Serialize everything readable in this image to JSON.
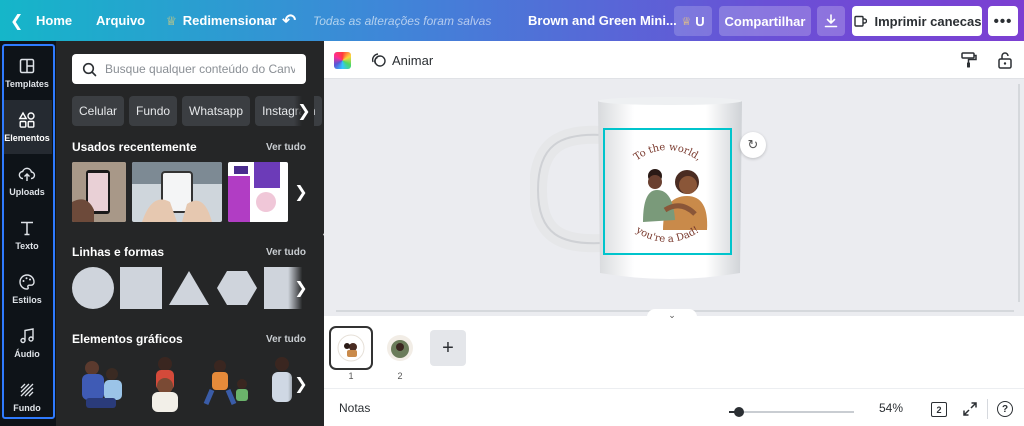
{
  "topbar": {
    "home": "Home",
    "file": "Arquivo",
    "resize": "Redimensionar",
    "saved_status": "Todas as alterações foram salvas",
    "doc_title": "Brown and Green Mini...",
    "upgrade_short": "U",
    "share": "Compartilhar",
    "print": "Imprimir canecas"
  },
  "rail": [
    {
      "label": "Templates",
      "icon": "templates-icon"
    },
    {
      "label": "Elementos",
      "icon": "elements-icon"
    },
    {
      "label": "Uploads",
      "icon": "upload-icon"
    },
    {
      "label": "Texto",
      "icon": "text-icon"
    },
    {
      "label": "Estilos",
      "icon": "palette-icon"
    },
    {
      "label": "Áudio",
      "icon": "music-icon"
    },
    {
      "label": "Fundo",
      "icon": "background-icon"
    }
  ],
  "panel": {
    "search_placeholder": "Busque qualquer conteúdo do Canva",
    "chips": [
      "Celular",
      "Fundo",
      "Whatsapp",
      "Instagram"
    ],
    "recent": {
      "title": "Usados recentemente",
      "link": "Ver tudo"
    },
    "shapes": {
      "title": "Linhas e formas",
      "link": "Ver tudo"
    },
    "graphics": {
      "title": "Elementos gráficos",
      "link": "Ver tudo"
    }
  },
  "editor": {
    "animate": "Animar"
  },
  "design": {
    "text_top": "To the world,",
    "text_bottom": "you're a Dad!"
  },
  "pages": {
    "numbers": [
      "1",
      "2"
    ]
  },
  "footer": {
    "notes": "Notas",
    "zoom": "54%",
    "zoom_fraction": 0.08,
    "page_count": "2"
  },
  "colors": {
    "accent": "#00c4cc",
    "topbar_start": "#15b6c9",
    "topbar_end": "#7c3fd2",
    "rail_outline": "#2f7bff"
  }
}
